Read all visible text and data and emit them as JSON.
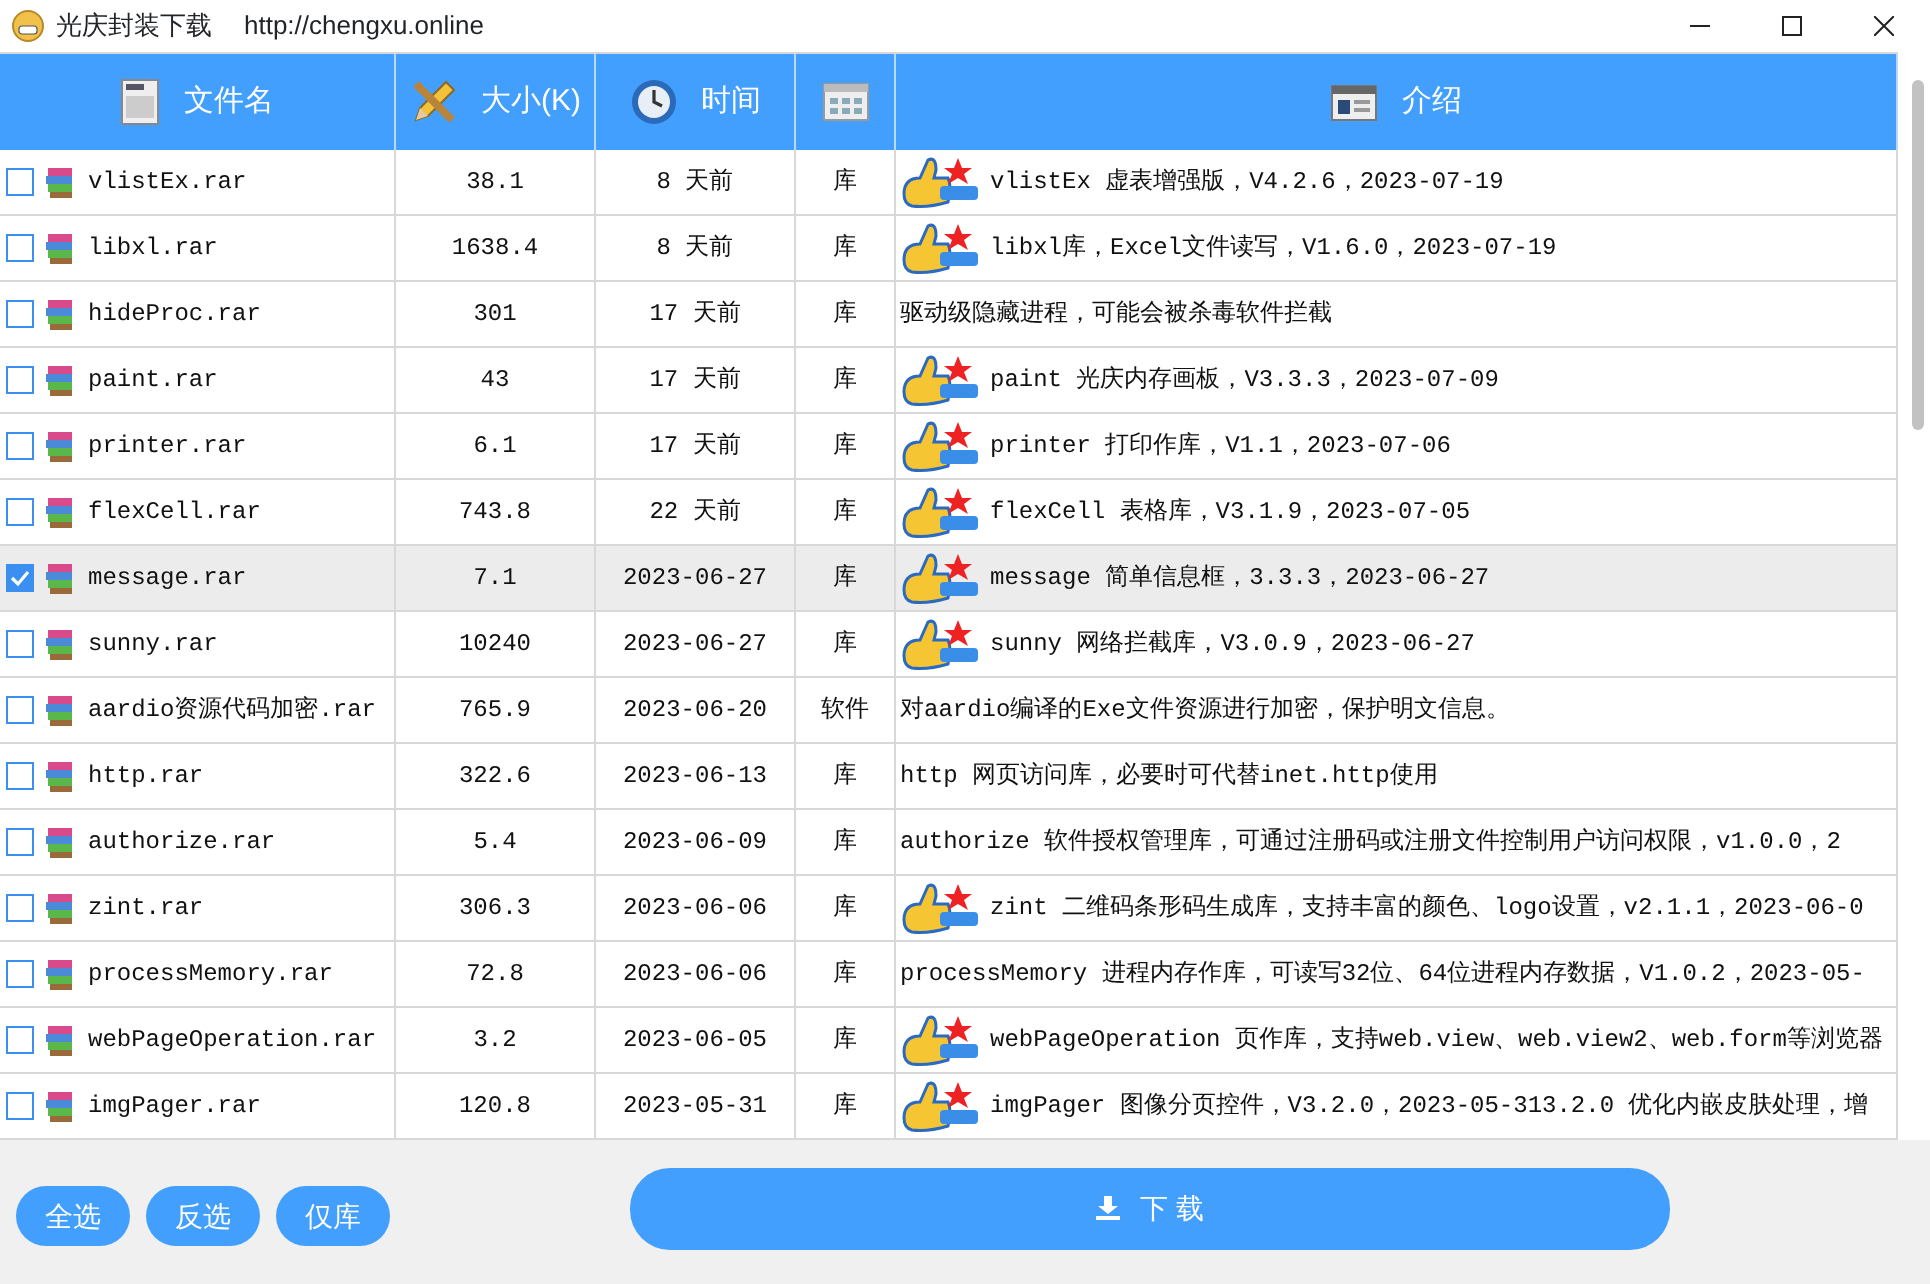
{
  "window": {
    "title": "光庆封装下载",
    "url": "http://chengxu.online"
  },
  "table": {
    "columns": [
      {
        "label": "文件名"
      },
      {
        "label": "大小(K)"
      },
      {
        "label": "时间"
      },
      {},
      {
        "label": "介绍"
      }
    ],
    "rows": [
      {
        "checked": false,
        "recommended": true,
        "name": "vlistEx.rar",
        "size": "38.1",
        "time": "8 天前",
        "type": "库",
        "description": "vlistEx 虚表增强版，V4.2.6，2023-07-19"
      },
      {
        "checked": false,
        "recommended": true,
        "name": "libxl.rar",
        "size": "1638.4",
        "time": "8 天前",
        "type": "库",
        "description": "libxl库，Excel文件读写，V1.6.0，2023-07-19"
      },
      {
        "checked": false,
        "recommended": false,
        "name": "hideProc.rar",
        "size": "301",
        "time": "17 天前",
        "type": "库",
        "description": "驱动级隐藏进程，可能会被杀毒软件拦截"
      },
      {
        "checked": false,
        "recommended": true,
        "name": "paint.rar",
        "size": "43",
        "time": "17 天前",
        "type": "库",
        "description": "paint 光庆内存画板，V3.3.3，2023-07-09"
      },
      {
        "checked": false,
        "recommended": true,
        "name": "printer.rar",
        "size": "6.1",
        "time": "17 天前",
        "type": "库",
        "description": "printer 打印作库，V1.1，2023-07-06"
      },
      {
        "checked": false,
        "recommended": true,
        "name": "flexCell.rar",
        "size": "743.8",
        "time": "22 天前",
        "type": "库",
        "description": "flexCell 表格库，V3.1.9，2023-07-05"
      },
      {
        "checked": true,
        "recommended": true,
        "name": "message.rar",
        "size": "7.1",
        "time": "2023-06-27",
        "type": "库",
        "description": "message 简单信息框，3.3.3，2023-06-27"
      },
      {
        "checked": false,
        "recommended": true,
        "name": "sunny.rar",
        "size": "10240",
        "time": "2023-06-27",
        "type": "库",
        "description": "sunny 网络拦截库，V3.0.9，2023-06-27"
      },
      {
        "checked": false,
        "recommended": false,
        "name": "aardio资源代码加密.rar",
        "size": "765.9",
        "time": "2023-06-20",
        "type": "软件",
        "description": "对aardio编译的Exe文件资源进行加密，保护明文信息。"
      },
      {
        "checked": false,
        "recommended": false,
        "name": "http.rar",
        "size": "322.6",
        "time": "2023-06-13",
        "type": "库",
        "description": "http 网页访问库，必要时可代替inet.http使用"
      },
      {
        "checked": false,
        "recommended": false,
        "name": "authorize.rar",
        "size": "5.4",
        "time": "2023-06-09",
        "type": "库",
        "description": "authorize 软件授权管理库，可通过注册码或注册文件控制用户访问权限，v1.0.0，2"
      },
      {
        "checked": false,
        "recommended": true,
        "name": "zint.rar",
        "size": "306.3",
        "time": "2023-06-06",
        "type": "库",
        "description": "zint 二维码条形码生成库，支持丰富的颜色、logo设置，v2.1.1，2023-06-0"
      },
      {
        "checked": false,
        "recommended": false,
        "name": "processMemory.rar",
        "size": "72.8",
        "time": "2023-06-06",
        "type": "库",
        "description": "processMemory 进程内存作库，可读写32位、64位进程内存数据，V1.0.2，2023-05-"
      },
      {
        "checked": false,
        "recommended": true,
        "name": "webPageOperation.rar",
        "size": "3.2",
        "time": "2023-06-05",
        "type": "库",
        "description": "webPageOperation 页作库，支持web.view、web.view2、web.form等浏览器"
      },
      {
        "checked": false,
        "recommended": true,
        "name": "imgPager.rar",
        "size": "120.8",
        "time": "2023-05-31",
        "type": "库",
        "description": "imgPager 图像分页控件，V3.2.0，2023-05-313.2.0 优化内嵌皮肤处理，增"
      }
    ]
  },
  "footer": {
    "buttons": [
      "全选",
      "反选",
      "仅库"
    ],
    "download": "下 载"
  }
}
